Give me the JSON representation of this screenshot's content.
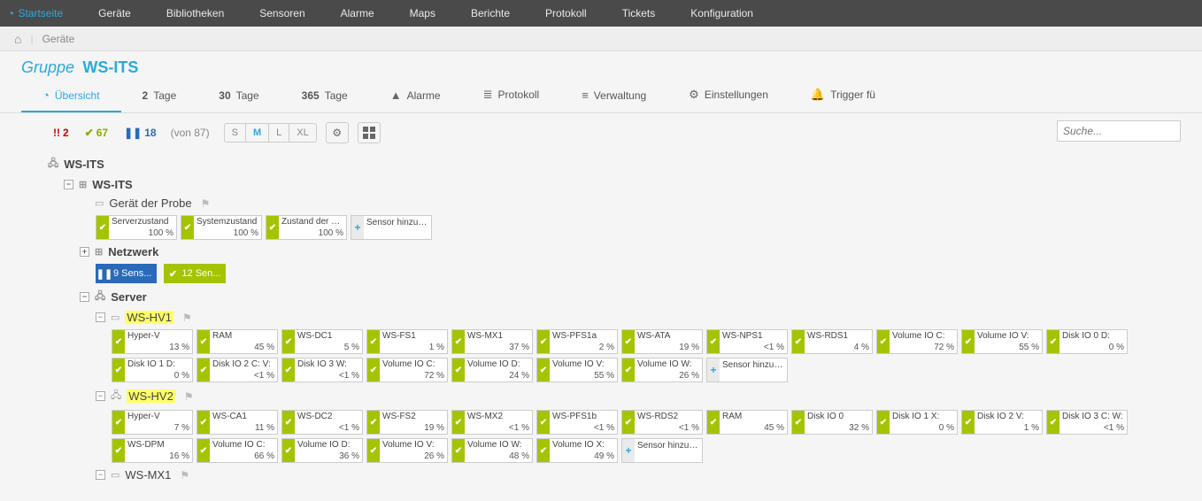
{
  "topnav": {
    "home_label": "Startseite",
    "items": [
      "Geräte",
      "Bibliotheken",
      "Sensoren",
      "Alarme",
      "Maps",
      "Berichte",
      "Protokoll",
      "Tickets",
      "Konfiguration"
    ]
  },
  "breadcrumb": {
    "item": "Geräte"
  },
  "group": {
    "prefix": "Gruppe",
    "name": "WS-ITS"
  },
  "tabs": {
    "overview": "Übersicht",
    "t2_num": "2",
    "t2_label": "Tage",
    "t30_num": "30",
    "t30_label": "Tage",
    "t365_num": "365",
    "t365_label": "Tage",
    "alarms": "Alarme",
    "protocol": "Protokoll",
    "admin": "Verwaltung",
    "settings": "Einstellungen",
    "trigger": "Trigger fü"
  },
  "counts": {
    "error_sym": "!!",
    "error": "2",
    "ok_sym": "✔",
    "ok": "67",
    "pause_sym": "❚❚",
    "pause": "18",
    "total": "(von 87)"
  },
  "sizes": {
    "s": "S",
    "m": "M",
    "l": "L",
    "xl": "XL"
  },
  "search": {
    "placeholder": "Suche..."
  },
  "tree": {
    "root": "WS-ITS",
    "probe_group": "WS-ITS",
    "probe_device": "Gerät der Probe",
    "net": {
      "label": "Netzwerk",
      "chip_pause": "9 Sens...",
      "chip_ok": "12 Sen..."
    },
    "server": "Server",
    "hv1": "WS-HV1",
    "hv2": "WS-HV2",
    "mx1": "WS-MX1",
    "add_sensor": "Sensor hinzufügen"
  },
  "probe_sensors": [
    {
      "name": "Serverzustand",
      "val": "100 %"
    },
    {
      "name": "Systemzustand",
      "val": "100 %"
    },
    {
      "name": "Zustand der Pr...",
      "val": "100 %"
    }
  ],
  "hv1_row1": [
    {
      "name": "Hyper-V",
      "val": "13 %"
    },
    {
      "name": "RAM",
      "val": "45 %"
    },
    {
      "name": "WS-DC1",
      "val": "5 %"
    },
    {
      "name": "WS-FS1",
      "val": "1 %"
    },
    {
      "name": "WS-MX1",
      "val": "37 %"
    },
    {
      "name": "WS-PFS1a",
      "val": "2 %"
    },
    {
      "name": "WS-ATA",
      "val": "19 %"
    },
    {
      "name": "WS-NPS1",
      "val": "<1 %"
    },
    {
      "name": "WS-RDS1",
      "val": "4 %"
    },
    {
      "name": "Volume IO C:",
      "val": "72 %"
    },
    {
      "name": "Volume IO V:",
      "val": "55 %"
    },
    {
      "name": "Disk IO 0 D:",
      "val": "0 %"
    }
  ],
  "hv1_row2": [
    {
      "name": "Disk IO 1 D:",
      "val": "0 %"
    },
    {
      "name": "Disk IO 2 C: V:",
      "val": "<1 %"
    },
    {
      "name": "Disk IO 3 W:",
      "val": "<1 %"
    },
    {
      "name": "Volume IO C:",
      "val": "72 %"
    },
    {
      "name": "Volume IO D:",
      "val": "24 %"
    },
    {
      "name": "Volume IO V:",
      "val": "55 %"
    },
    {
      "name": "Volume IO W:",
      "val": "26 %"
    }
  ],
  "hv2_row1": [
    {
      "name": "Hyper-V",
      "val": "7 %"
    },
    {
      "name": "WS-CA1",
      "val": "11 %"
    },
    {
      "name": "WS-DC2",
      "val": "<1 %"
    },
    {
      "name": "WS-FS2",
      "val": "19 %"
    },
    {
      "name": "WS-MX2",
      "val": "<1 %"
    },
    {
      "name": "WS-PFS1b",
      "val": "<1 %"
    },
    {
      "name": "WS-RDS2",
      "val": "<1 %"
    },
    {
      "name": "RAM",
      "val": "45 %"
    },
    {
      "name": "Disk IO 0",
      "val": "32 %"
    },
    {
      "name": "Disk IO 1 X:",
      "val": "0 %"
    },
    {
      "name": "Disk IO 2 V:",
      "val": "1 %"
    },
    {
      "name": "Disk IO 3 C: W:",
      "val": "<1 %"
    }
  ],
  "hv2_row2": [
    {
      "name": "WS-DPM",
      "val": "16 %"
    },
    {
      "name": "Volume IO C:",
      "val": "66 %"
    },
    {
      "name": "Volume IO D:",
      "val": "36 %"
    },
    {
      "name": "Volume IO V:",
      "val": "26 %"
    },
    {
      "name": "Volume IO W:",
      "val": "48 %"
    },
    {
      "name": "Volume IO X:",
      "val": "49 %"
    }
  ]
}
